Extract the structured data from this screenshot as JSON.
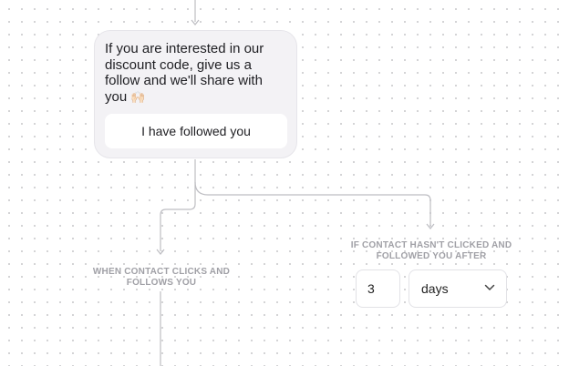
{
  "message_card": {
    "text": "If you are interested in our discount code, give us a follow and we'll share with you",
    "emoji": "🙌🏻",
    "button_label": "I have followed you"
  },
  "branches": {
    "clicked_label": "WHEN CONTACT CLICKS AND FOLLOWS YOU",
    "not_clicked_label": "IF CONTACT HASN'T CLICKED AND FOLLOWED YOU AFTER",
    "delay_value": "3",
    "delay_unit": "days"
  },
  "icons": {
    "unit_dropdown": "chevron-down-icon"
  },
  "colors": {
    "card_background": "#f3f2f5",
    "connector": "#bdbdc2",
    "label_text": "#a0a0a6",
    "canvas_dots": "#c9c9cc"
  }
}
